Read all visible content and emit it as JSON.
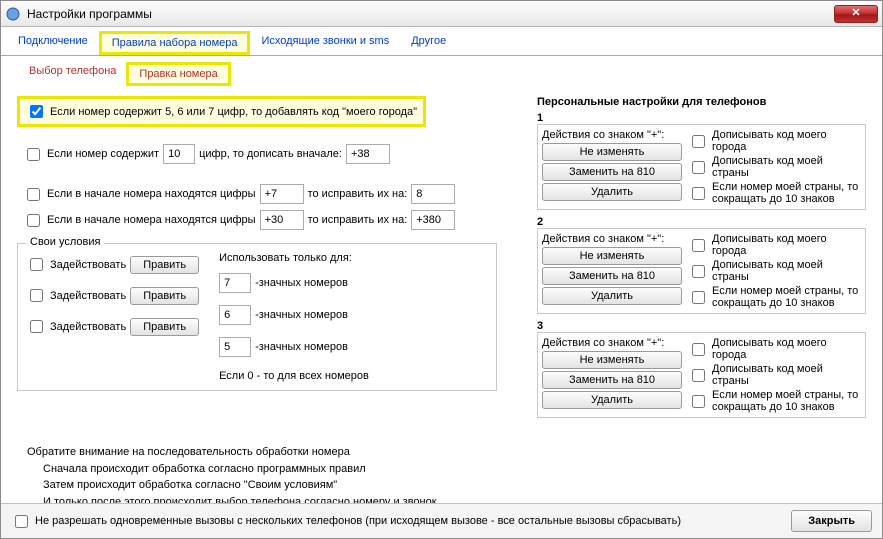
{
  "window": {
    "title": "Настройки программы"
  },
  "tabs_top": {
    "items": [
      "Подключение",
      "Правила набора номера",
      "Исходящие звонки и sms",
      "Другое"
    ],
    "highlighted": 1
  },
  "subtabs": {
    "items": [
      "Выбор телефона",
      "Правка номера"
    ],
    "highlighted": 1
  },
  "main_check": {
    "checked": true,
    "label": "Если номер содержит 5, 6 или 7 цифр, то добавлять код \"моего города\""
  },
  "rule_digits": {
    "checked": false,
    "label_pre": "Если номер содержит",
    "value": "10",
    "label_mid": "цифр, то дописать вначале:",
    "prefix": "+38"
  },
  "rule_start1": {
    "checked": false,
    "label_pre": "Если в начале номера находятся цифры",
    "old": "+7",
    "label_mid": "то исправить их на:",
    "new": "8"
  },
  "rule_start2": {
    "checked": false,
    "label_pre": "Если в начале номера находятся цифры",
    "old": "+30",
    "label_mid": "то исправить их на:",
    "new": "+380"
  },
  "own_rules": {
    "legend": "Свои условия",
    "use_label": "Задействовать",
    "edit_btn": "Править",
    "only_for_label": "Использовать только для:",
    "suffix": "-значных номеров",
    "rows": [
      {
        "checked": false,
        "digits": "7"
      },
      {
        "checked": false,
        "digits": "6"
      },
      {
        "checked": false,
        "digits": "5"
      }
    ],
    "zero_note": "Если 0 - то для всех номеров"
  },
  "personal": {
    "title": "Персональные настройки для телефонов",
    "plus_label": "Действия со знаком \"+\":",
    "btn_keep": "Не изменять",
    "btn_replace": "Заменить на 810",
    "btn_delete": "Удалить",
    "chk_city": "Дописывать код моего города",
    "chk_country": "Дописывать код моей страны",
    "chk_trim": "Если номер моей страны, то сокращать до 10 знаков",
    "blocks": [
      "1",
      "2",
      "3"
    ]
  },
  "notes": {
    "l1": "Обратите внимание на последовательность обработки номера",
    "l2": "Сначала происходит обработка согласно программных правил",
    "l3": "Затем происходит обработка согласно \"Своим условиям\"",
    "l4": "И только после этого происходит выбор телефона согласно номеру и звонок"
  },
  "footer": {
    "disallow_multi": "Не разрешать одновременные вызовы с нескольких телефонов (при исходящем вызове - все остальные вызовы сбрасывать)",
    "close_btn": "Закрыть"
  }
}
